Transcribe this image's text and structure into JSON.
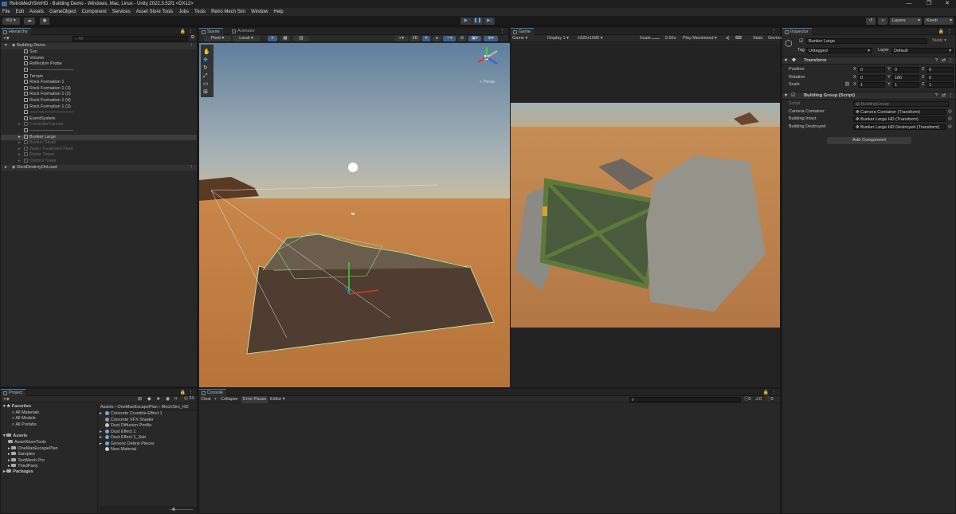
{
  "window": {
    "title": "RetroMechSimHD - Building Demo - Windows, Mac, Linux - Unity 2022.3.52f1 <DX12>",
    "controls": {
      "minimize": "—",
      "maximize": "❐",
      "close": "✕"
    }
  },
  "menu": [
    "File",
    "Edit",
    "Assets",
    "GameObject",
    "Component",
    "Services",
    "Asset Store Tools",
    "Jobs",
    "Tools",
    "Retro Mech Sim",
    "Window",
    "Help"
  ],
  "toolbar": {
    "account": "KV",
    "play_icons": {
      "play": "play-icon",
      "pause": "pause-icon",
      "step": "step-icon"
    },
    "layers_label": "Layers",
    "layout_label": "Kevin"
  },
  "hierarchy": {
    "tab": "Hierarchy",
    "search_placeholder": "All",
    "scene_name": "Building Demo",
    "items": [
      {
        "label": "Sun",
        "dim": false
      },
      {
        "label": "Volume",
        "dim": false
      },
      {
        "label": "Reflection Probe",
        "dim": false
      },
      {
        "label": "------------------------------",
        "dim": false
      },
      {
        "label": "Terrain",
        "dim": false
      },
      {
        "label": "Rock Formation 1",
        "dim": false
      },
      {
        "label": "Rock Formation 1 (1)",
        "dim": false
      },
      {
        "label": "Rock Formation 1 (2)",
        "dim": false
      },
      {
        "label": "Rock Formation 1 (4)",
        "dim": false
      },
      {
        "label": "Rock Formation 1 (3)",
        "dim": false
      },
      {
        "label": "------------------------------",
        "dim": false
      },
      {
        "label": "EventSystem",
        "dim": false
      },
      {
        "label": "ControllerCanvas",
        "dim": true
      },
      {
        "label": "------------------------------",
        "dim": false
      },
      {
        "label": "Bunker Large",
        "dim": false
      },
      {
        "label": "Bunker Small",
        "dim": true
      },
      {
        "label": "Water Treatment Plant",
        "dim": true
      },
      {
        "label": "Radar Tower",
        "dim": true
      },
      {
        "label": "Control Tower",
        "dim": true
      }
    ],
    "dont_destroy": "DontDestroyOnLoad"
  },
  "scene": {
    "tabs": [
      "Scene",
      "Animator"
    ],
    "pivot": "Pivot",
    "space": "Local",
    "mode_2d": "2D",
    "gizmo_label": "< Persp"
  },
  "game": {
    "tab": "Game",
    "mode": "Game",
    "display": "Display 1",
    "resolution": "1920x1080",
    "scale_label": "Scale",
    "scale_value": "0.56x",
    "play_mode": "Play Maximized",
    "stats": "Stats",
    "gizmos": "Gizmos"
  },
  "inspector": {
    "tab": "Inspector",
    "object_name": "Bunker Large",
    "static_label": "Static",
    "tag_label": "Tag",
    "tag_value": "Untagged",
    "layer_label": "Layer",
    "layer_value": "Default",
    "transform": {
      "title": "Transform",
      "position": {
        "label": "Position",
        "x": "0",
        "y": "0",
        "z": "0"
      },
      "rotation": {
        "label": "Rotation",
        "x": "0",
        "y": "180",
        "z": "0"
      },
      "scale": {
        "label": "Scale",
        "x": "1",
        "y": "1",
        "z": "1"
      }
    },
    "axis": {
      "x": "X",
      "y": "Y",
      "z": "Z"
    },
    "building_group": {
      "title": "Building Group (Script)",
      "script_label": "Script",
      "script_value": "BuildingGroup",
      "fields": [
        {
          "label": "Camera Container",
          "value": "Camera Container (Transform)"
        },
        {
          "label": "Building Intact",
          "value": "Bunker Large HD (Transform)"
        },
        {
          "label": "Building Destroyed",
          "value": "Bunker Large HD Destroyed (Transform)"
        }
      ]
    },
    "add_component": "Add Component"
  },
  "project": {
    "tab": "Project",
    "badge": "23",
    "favorites": {
      "label": "Favorites",
      "items": [
        "All Materials",
        "All Models",
        "All Prefabs"
      ]
    },
    "assets": {
      "label": "Assets",
      "items": [
        "AssetStoreTools",
        "OneManEscapePlan",
        "Samples",
        "TextMesh Pro",
        "ThirdParty"
      ]
    },
    "packages": "Packages",
    "breadcrumb": [
      "Assets",
      "OneManEscapePlan",
      "MechSim_HD"
    ],
    "files": [
      {
        "label": "Concrete Crumble Effect 1",
        "expand": true,
        "color": "#7aa7d6"
      },
      {
        "label": "Concrete VFX Shader",
        "expand": false,
        "color": "#9c9c9c"
      },
      {
        "label": "Dust Diffusion Profile",
        "expand": false,
        "color": "#c8c8c8"
      },
      {
        "label": "Dust Effect 1",
        "expand": true,
        "color": "#7aa7d6"
      },
      {
        "label": "Dust Effect 1_Sub",
        "expand": true,
        "color": "#7aa7d6"
      },
      {
        "label": "Generic Debris Pieces",
        "expand": true,
        "color": "#5fb0e0"
      },
      {
        "label": "New Material",
        "expand": false,
        "color": "#d0d0d0"
      }
    ]
  },
  "console": {
    "tab": "Console",
    "buttons": [
      "Clear",
      "Collapse",
      "Error Pause",
      "Editor"
    ],
    "counts": [
      "0",
      "0",
      "0"
    ]
  }
}
